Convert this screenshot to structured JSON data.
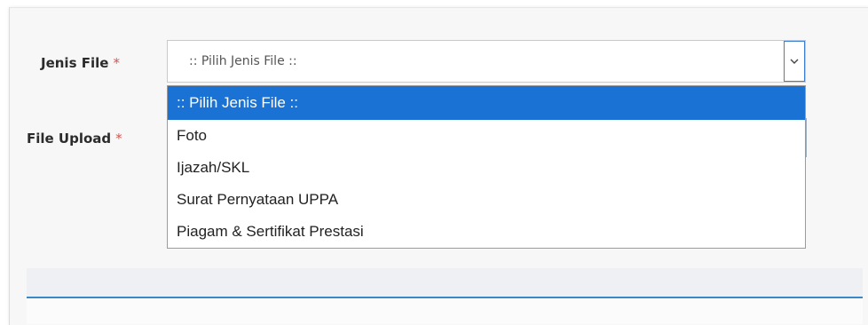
{
  "form": {
    "jenis_file": {
      "label": "Jenis File",
      "required_mark": "*",
      "selected_value": ":: Pilih Jenis File ::"
    },
    "file_upload": {
      "label": "File Upload",
      "required_mark": "*"
    }
  },
  "dropdown": {
    "options": [
      ":: Pilih Jenis File ::",
      "Foto",
      "Ijazah/SKL",
      "Surat Pernyataan UPPA",
      "Piagam & Sertifikat Prestasi"
    ],
    "highlighted_index": 0
  },
  "icons": {
    "select_arrow": "chevron-down-icon"
  },
  "colors": {
    "highlight": "#1a73d4",
    "required": "#d9534f",
    "accent_line": "#3a88c8"
  }
}
